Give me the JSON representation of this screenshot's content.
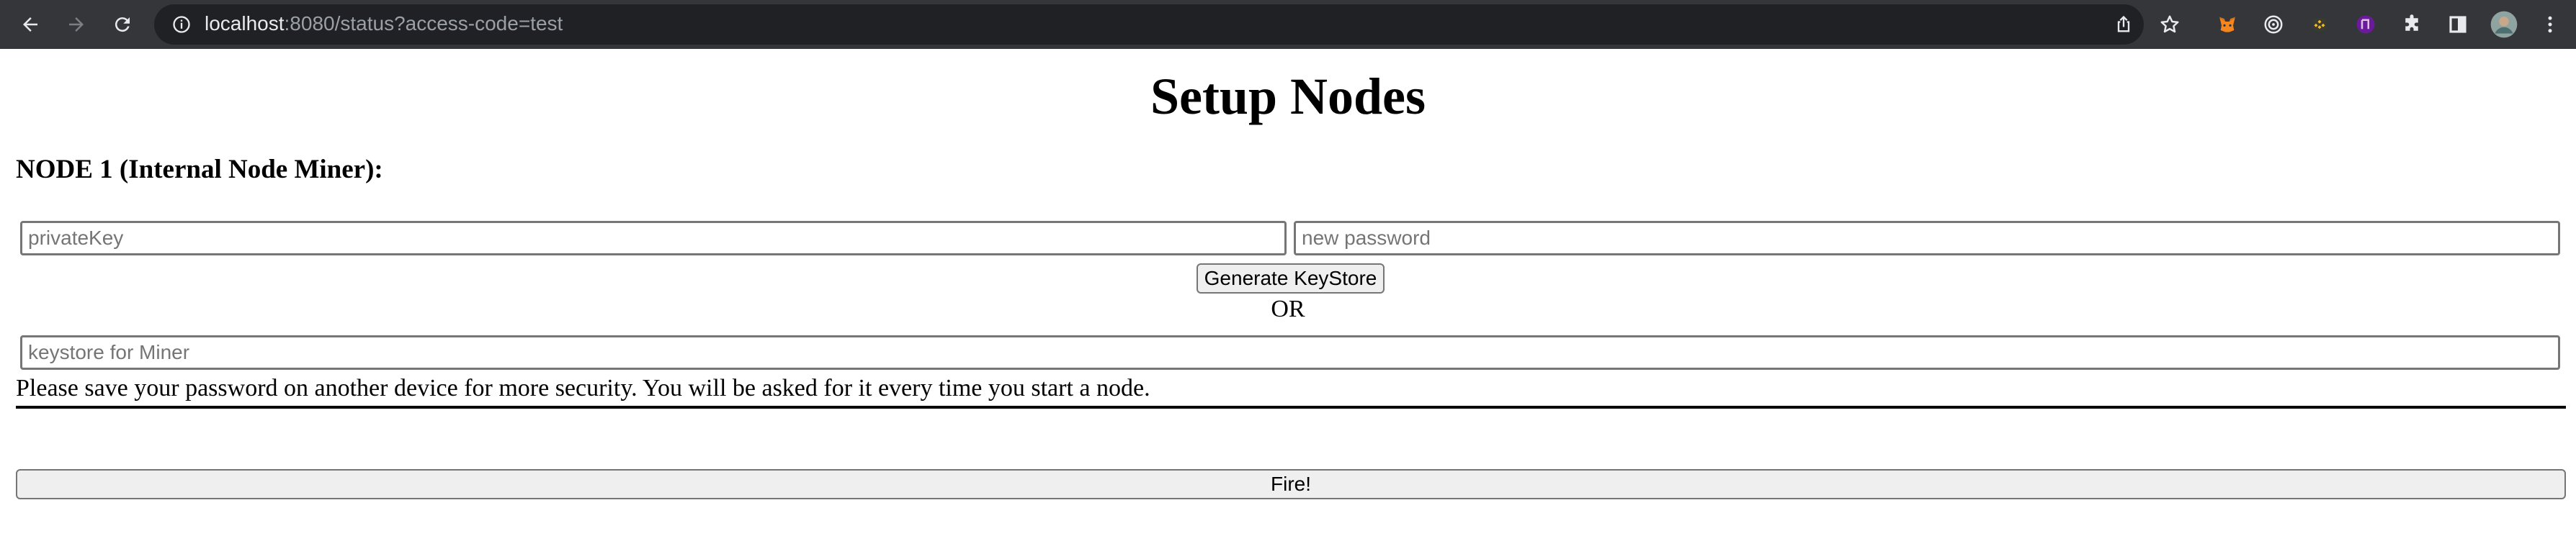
{
  "browser": {
    "url_host": "localhost",
    "url_rest": ":8080/status?access-code=test",
    "icons": [
      "back-arrow-icon",
      "forward-arrow-icon",
      "reload-icon",
      "info-icon",
      "share-icon",
      "bookmark-star-icon",
      "metamask-extension-icon",
      "target-extension-icon",
      "binance-extension-icon",
      "purple-extension-icon",
      "puzzle-extensions-icon",
      "sidebar-icon",
      "profile-avatar",
      "kebab-menu-icon"
    ]
  },
  "page": {
    "title": "Setup Nodes",
    "node_heading": "NODE 1 (Internal Node Miner):",
    "private_key_placeholder": "privateKey",
    "new_password_placeholder": "new password",
    "generate_button": "Generate KeyStore",
    "or_text": "OR",
    "keystore_placeholder": "keystore for Miner",
    "note": "Please save your password on another device for more security. You will be asked for it every time you start a node.",
    "fire_button": "Fire!"
  }
}
